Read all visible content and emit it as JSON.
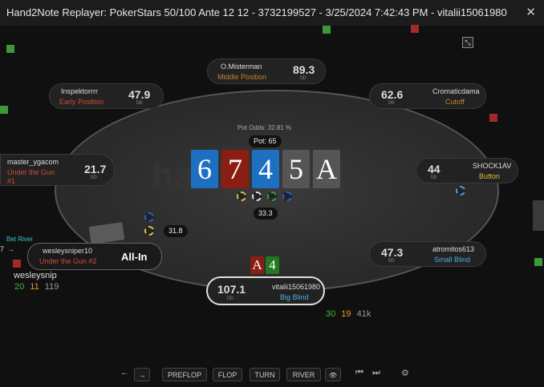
{
  "window": {
    "title": "Hand2Note Replayer: PokerStars 50/100 Ante 12 12 - 3732199527 - 3/25/2024 7:42:43 PM - vitalii15061980",
    "close": "✕"
  },
  "table": {
    "watermark": "hand2note",
    "pot_odds": "Pot Odds: 32.81 %",
    "pot": "Pot: 65",
    "center_bet": "33.3",
    "board": [
      "6",
      "7",
      "4",
      "5",
      "A"
    ],
    "hero_cards": [
      "A",
      "4"
    ]
  },
  "seats": {
    "omisterman": {
      "name": "O.Misterman",
      "position": "Middle Position",
      "stack": "89.3",
      "unit": "bb"
    },
    "inspektorrrr": {
      "name": "Inspektorrrr",
      "position": "Early Position",
      "stack": "47.9",
      "unit": "bb"
    },
    "cromaticdama": {
      "name": "Cromaticdama",
      "position": "Cutoff",
      "stack": "62.6",
      "unit": "bb"
    },
    "master": {
      "name": "master_ygacom",
      "position": "Under the Gun\n#1",
      "stack": "21.7",
      "unit": "bb"
    },
    "shock": {
      "name": "SHOCK1AV",
      "position": "Button",
      "stack": "44",
      "unit": "bb"
    },
    "wesley": {
      "name": "wesleysniper10",
      "position": "Under the Gun #2",
      "status": "All-In",
      "bet": "31.8",
      "action": "Bet River",
      "action_num": "7"
    },
    "atromitos": {
      "name": "atromitos613",
      "position": "Small Blind",
      "stack": "47.3",
      "unit": "bb"
    },
    "hero": {
      "name": "vitalii15061980",
      "position": "Big Blind",
      "stack": "107.1",
      "unit": "bb"
    }
  },
  "stats": {
    "wesley": {
      "name": "wesleysnip",
      "a": "20",
      "b": "11",
      "c": "119"
    },
    "hero": {
      "a": "30",
      "b": "19",
      "c": "41k"
    }
  },
  "controls": {
    "prev": "←",
    "next": "→",
    "preflop": "PREFLOP",
    "flop": "FLOP",
    "turn": "TURN",
    "river": "RIVER",
    "eye": "👁",
    "first": "⏮",
    "last": "⏭",
    "settings": "⚙"
  },
  "colors": {
    "blue_card": "#1e6fc2",
    "red_card": "#8b1e14",
    "gray_card": "#555555",
    "green_card": "#1f7a1f"
  }
}
